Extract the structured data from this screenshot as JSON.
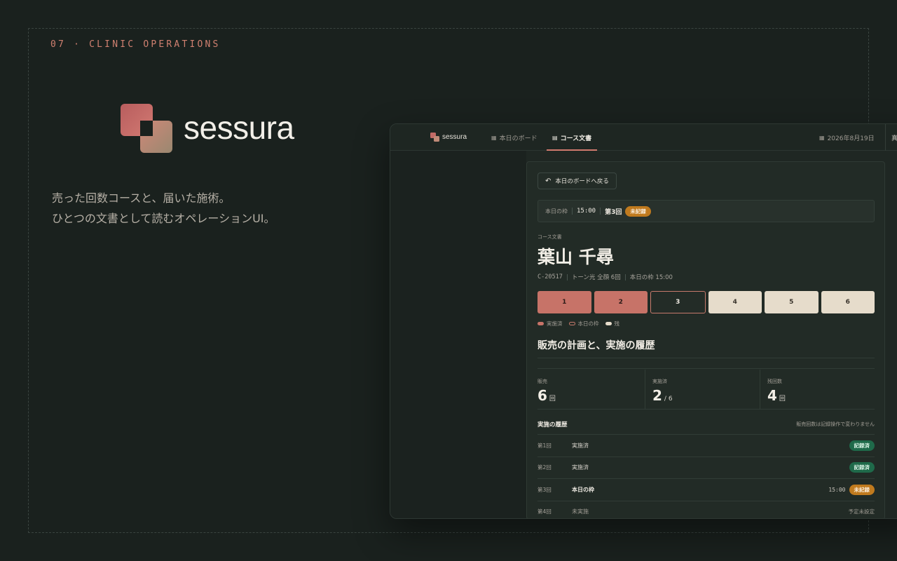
{
  "eyebrow": "07 · CLINIC OPERATIONS",
  "brand": {
    "name": "sessura"
  },
  "tagline": {
    "line1": "売った回数コースと、届いた施術。",
    "line2": "ひとつの文書として読むオペレーションUI。"
  },
  "app": {
    "logo_text": "sessura",
    "tabs": [
      {
        "label": "本日のボード",
        "icon": "calendar-icon"
      },
      {
        "label": "コース文書",
        "icon": "document-icon",
        "active": true
      }
    ],
    "date": "2026年8月19日",
    "user": "真澄"
  },
  "doc": {
    "back_label": "本日のボードへ戻る",
    "slot": {
      "label": "本日の枠",
      "time": "15:00",
      "round": "第3回",
      "status": "未記録"
    },
    "doc_label": "コース文書",
    "patient_name": "葉山 千尋",
    "meta": {
      "id": "C-20517",
      "course": "トーン光 全顔 6回",
      "today_slot": "本日の枠 15:00"
    },
    "sessions": [
      {
        "num": "1",
        "state": "done"
      },
      {
        "num": "2",
        "state": "done"
      },
      {
        "num": "3",
        "state": "today"
      },
      {
        "num": "4",
        "state": "rest"
      },
      {
        "num": "5",
        "state": "rest"
      },
      {
        "num": "6",
        "state": "rest"
      }
    ],
    "legend": [
      {
        "label": "実施済",
        "color": "#c77368"
      },
      {
        "label": "本日の枠",
        "color": "#c77a6c"
      },
      {
        "label": "残",
        "color": "#e6dccb"
      }
    ],
    "section_title": "販売の計画と、実施の履歴",
    "stats": {
      "sold": {
        "label": "販売",
        "value": "6",
        "unit": "回"
      },
      "done": {
        "label": "実施済",
        "value": "2",
        "unit": "/ 6"
      },
      "remaining": {
        "label": "残回数",
        "value": "4",
        "unit": "回"
      }
    },
    "history": {
      "title": "実施の履歴",
      "note": "販売回数は記録操作で変わりません",
      "rows": [
        {
          "num": "第1回",
          "status": "実施済",
          "badge": "記録済"
        },
        {
          "num": "第2回",
          "status": "実施済",
          "badge": "記録済"
        },
        {
          "num": "第3回",
          "status": "本日の枠",
          "time": "15:00",
          "badge": "未記録"
        },
        {
          "num": "第4回",
          "status": "未実施",
          "plain": "予定未設定"
        }
      ]
    }
  }
}
